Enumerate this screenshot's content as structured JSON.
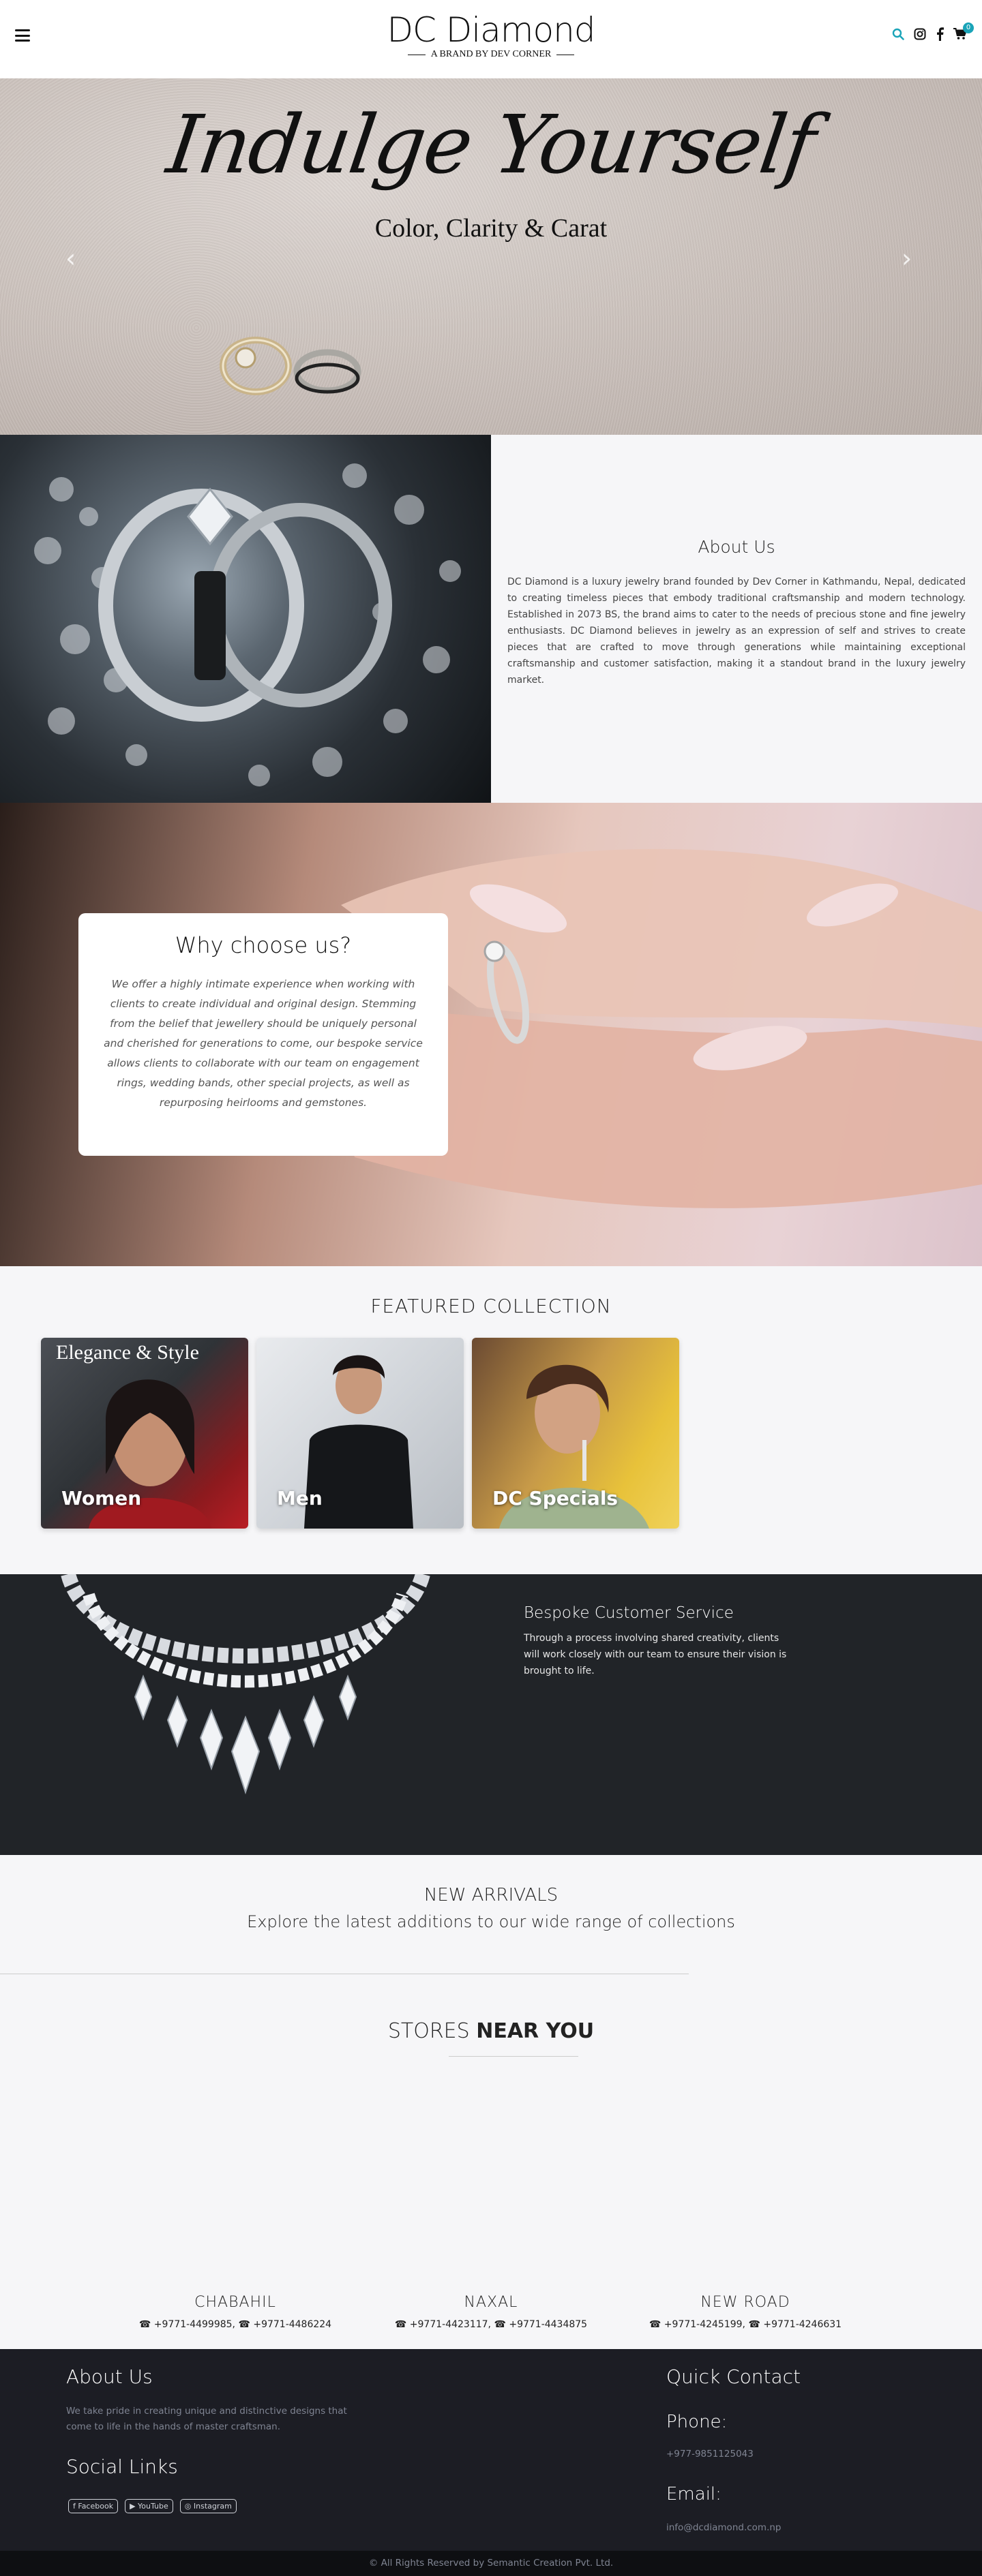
{
  "header": {
    "logo_title": "DC Diamond",
    "logo_tagline": "A BRAND BY DEV CORNER",
    "menu_icon": "hamburger-icon",
    "icons": [
      "search-icon",
      "instagram-icon",
      "facebook-icon",
      "cart-icon"
    ],
    "cart_count": "0",
    "accent_color": "#1aa4b8"
  },
  "hero": {
    "title": "Indulge Yourself",
    "subtitle": "Color, Clarity & Carat",
    "prev": "‹",
    "next": "›"
  },
  "about": {
    "title": "About Us",
    "body": "DC Diamond is a luxury jewelry brand founded by Dev Corner in Kathmandu, Nepal, dedicated to creating timeless pieces that embody traditional craftsmanship and modern technology. Established in 2073 BS, the brand aims to cater to the needs of precious stone and fine jewelry enthusiasts. DC Diamond believes in jewelry as an expression of self and strives to create pieces that are crafted to move through generations while maintaining exceptional craftsmanship and customer satisfaction, making it a standout brand in the luxury jewelry market."
  },
  "why": {
    "title": "Why choose us?",
    "body": "We offer a highly intimate experience when working with clients to create individual and original design. Stemming from the belief that jewellery should be uniquely personal and cherished for generations to come, our bespoke service allows clients to collaborate with our team on engagement rings, wedding bands, other special projects, as well as repurposing heirlooms and gemstones."
  },
  "featured": {
    "title": "FEATURED COLLECTION",
    "overlay": "Elegance & Style",
    "cards": [
      {
        "label": "Women"
      },
      {
        "label": "Men"
      },
      {
        "label": "DC Specials"
      }
    ]
  },
  "bespoke": {
    "title": "Bespoke Customer Service",
    "body": "Through a process involving shared creativity, clients will work closely with our team to ensure their vision is brought to life."
  },
  "arrivals": {
    "title": "NEW ARRIVALS",
    "subtitle": "Explore the latest additions to our wide range of collections"
  },
  "stores": {
    "title_plain": "STORES ",
    "title_bold": "NEAR YOU",
    "list": [
      {
        "name": "CHABAHIL",
        "phones": "+9771-4499985, ☎ +9771-4486224"
      },
      {
        "name": "NAXAL",
        "phones": "+9771-4423117, ☎ +9771-4434875"
      },
      {
        "name": "NEW ROAD",
        "phones": "+9771-4245199, ☎ +9771-4246631"
      }
    ]
  },
  "footer": {
    "about_title": "About Us",
    "about_body": "We take pride in creating unique and distinctive designs that come to life in the hands of master craftsman.",
    "social_title": "Social Links",
    "social": [
      "Facebook",
      "YouTube",
      "Instagram"
    ],
    "quick_title": "Quick Contact",
    "phone_title": "Phone:",
    "phone": "+977-9851125043",
    "email_title": "Email:",
    "email": "info@dcdiamond.com.np",
    "copyright": "© All Rights Reserved by Semantic Creation Pvt. Ltd."
  }
}
